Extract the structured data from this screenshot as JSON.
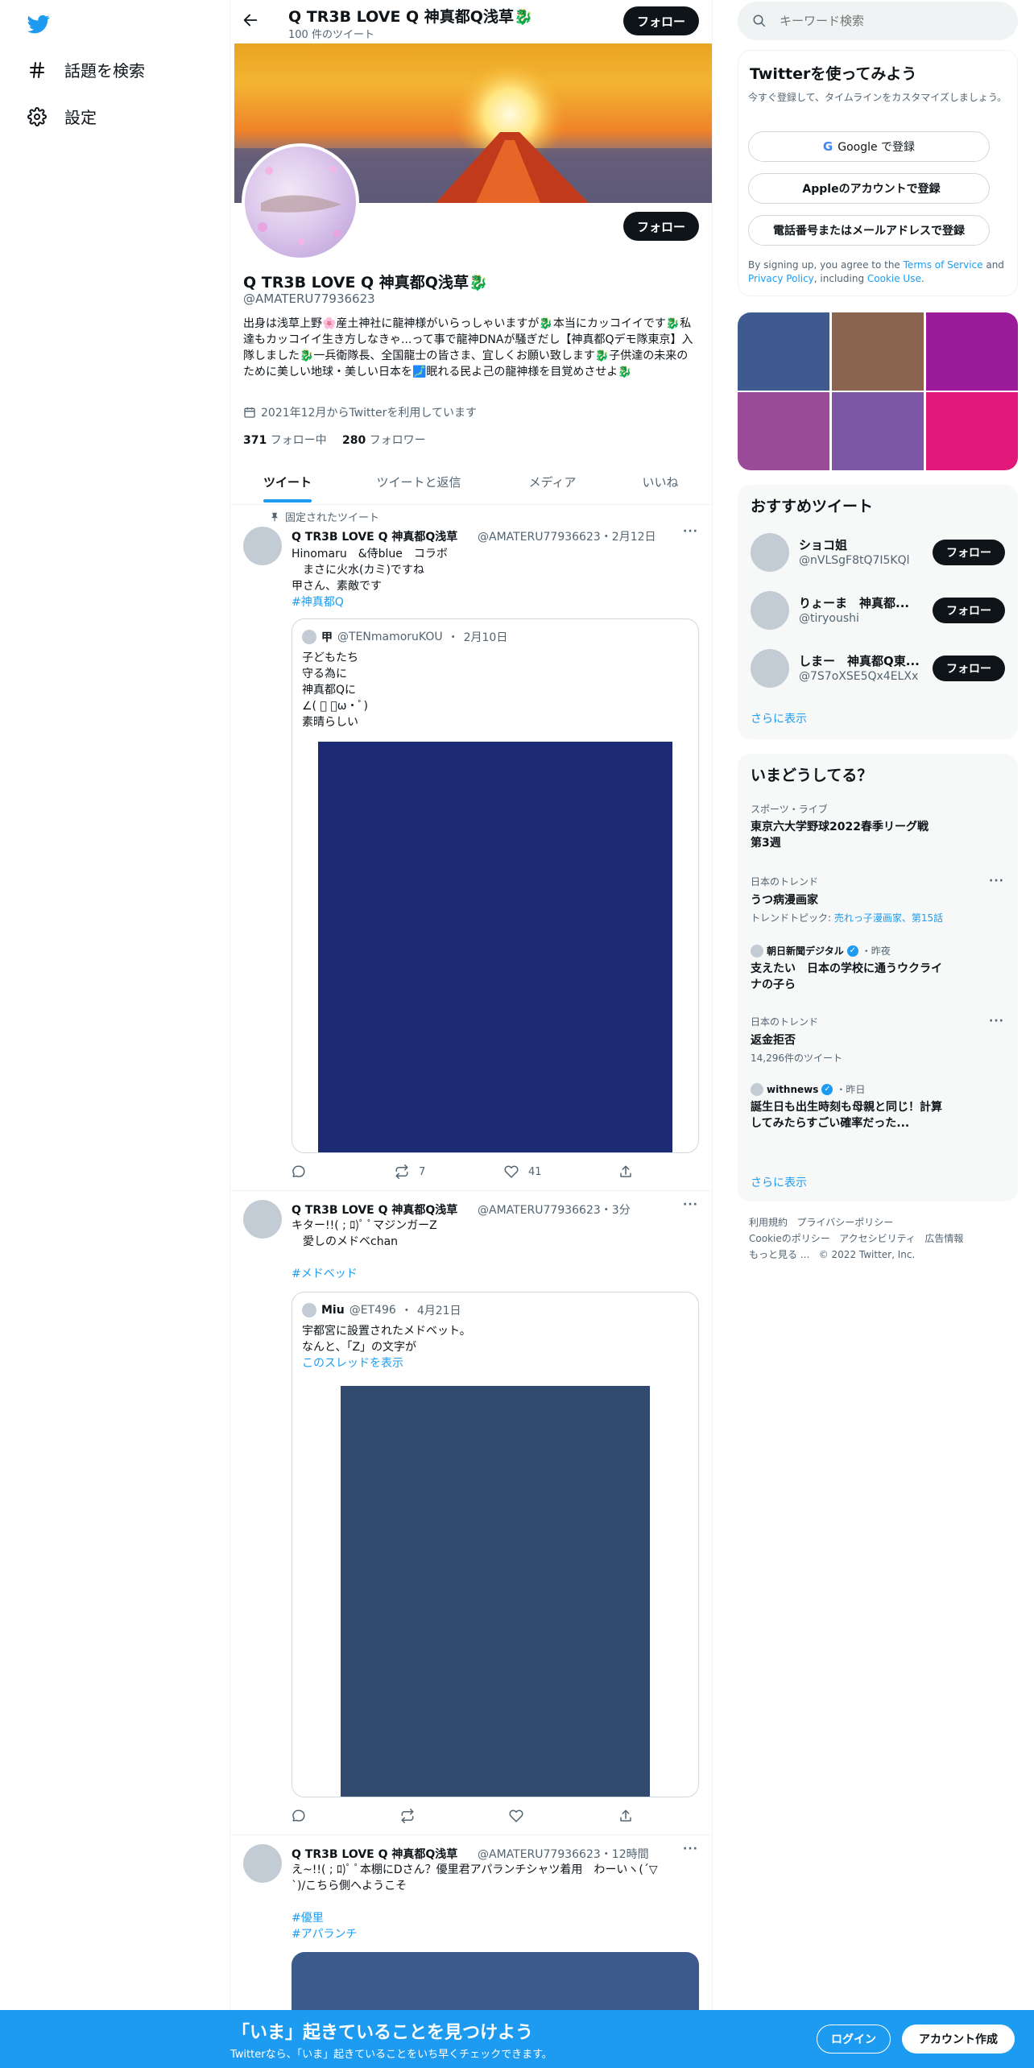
{
  "nav": {
    "explore_label": "話題を検索",
    "settings_label": "設定"
  },
  "profile_header": {
    "name": "Q TR3B LOVE Q 神真都Q浅草🐉",
    "tweet_count": "100 件のツイート",
    "follow_label": "フォロー"
  },
  "profile": {
    "name": "Q TR3B LOVE Q 神真都Q浅草🐉",
    "handle": "@AMATERU77936623",
    "bio": "出身は浅草上野🌸産土神社に龍神様がいらっしゃいますが🐉本当にカッコイイです🐉私達もカッコイイ生き方しなきゃ...って事で龍神DNAが騒ぎだし【神真都Qデモ隊東京】入隊しました🐉一兵衛隊長、全国龍士の皆さま、宜しくお願い致します🐉子供達の未来のために美しい地球・美しい日本を🗾眠れる民よ己の龍神様を目覚めさせよ🐉",
    "joined": "2021年12月からTwitterを利用しています",
    "following_count": "371",
    "following_label": "フォロー中",
    "followers_count": "280",
    "followers_label": "フォロワー",
    "follow_label": "フォロー"
  },
  "tabs": [
    "ツイート",
    "ツイートと返信",
    "メディア",
    "いいね"
  ],
  "tweets": [
    {
      "pinned_label": "固定されたツイート",
      "name": "Q TR3B LOVE Q 神真都Q浅草",
      "handle": "@AMATERU77936623",
      "time": "2月12日",
      "lines": [
        "Hinomaru　&侍blue　コラボ",
        "　まさに火水(カミ)ですね",
        "甲さん、素敵です"
      ],
      "hashtags": [
        "#神真都Q"
      ],
      "quote": {
        "name": "甲",
        "handle": "@TENmamoruKOU",
        "time": "2月10日",
        "lines": [
          "子どもたち",
          "守る為に",
          "神真都Qに",
          "∠( ﾟ ・ω・ﾟ)",
          "素晴らしい"
        ],
        "image_color": "#1b2a72"
      },
      "retweets": "7",
      "likes": "41"
    },
    {
      "name": "Q TR3B LOVE Q 神真都Q浅草",
      "handle": "@AMATERU77936623",
      "time": "3分",
      "lines": [
        "キター!!( ; ﾛ)ﾟ ﾟマジンガーZ",
        "　愛しのメドベchan"
      ],
      "hashtags": [
        "#メドベッド"
      ],
      "quote": {
        "name": "Miu",
        "handle": "@ET496",
        "time": "4月21日",
        "lines": [
          "宇都宮に設置されたメドベット。",
          "なんと、「Z」の文字が"
        ],
        "thread_link": "このスレッドを表示",
        "image_color": "#324a6d"
      },
      "retweets": "",
      "likes": ""
    },
    {
      "name": "Q TR3B LOVE Q 神真都Q浅草",
      "handle": "@AMATERU77936623",
      "time": "12時間",
      "lines": [
        "え~!!( ; ﾛ)ﾟ ﾟ本棚にDさん？優里君アパランチシャツ着用　わーいヽ(´▽",
        "`)/こちら側へようこそ"
      ],
      "hashtags": [
        "#優里",
        "#アパランチ"
      ],
      "image_color": "#3d5a8c"
    }
  ],
  "search": {
    "placeholder": "キーワード検索"
  },
  "signup": {
    "title": "Twitterを使ってみよう",
    "subtitle": "今すぐ登録して、タイムラインをカスタマイズしましょう。",
    "google_label": "Google で登録",
    "apple_label": "Appleのアカウントで登録",
    "phone_label": "電話番号またはメールアドレスで登録",
    "terms_prefix": "By signing up, you agree to the ",
    "terms_link": "Terms of Service",
    "terms_and": " and ",
    "privacy_link": "Privacy Policy",
    "terms_including": ", including ",
    "cookie_link": "Cookie Use",
    "terms_end": "."
  },
  "media_grid": {
    "colors": [
      "#3f5a8e",
      "#8b6450",
      "#9b1c9b",
      "#9b4a98",
      "#7e56a6",
      "#e0197a"
    ]
  },
  "recommended": {
    "title": "おすすめツイート",
    "users": [
      {
        "name": "ショコ姐",
        "handle": "@nVLSgF8tQ7I5KQl",
        "follow": "フォロー"
      },
      {
        "name": "りょーま　神真都...",
        "handle": "@tiryoushi",
        "follow": "フォロー"
      },
      {
        "name": "しまー　神真都Q東...",
        "handle": "@7S7oXSE5Qx4ELXx",
        "follow": "フォロー"
      }
    ],
    "more": "さらに表示"
  },
  "trends": {
    "title": "いまどうしてる？",
    "items": [
      {
        "context": "スポーツ・ライブ",
        "title": "東京六大学野球2022春季リーグ戦　第3週"
      },
      {
        "context": "日本のトレンド",
        "title": "うつ病漫画家",
        "sub_prefix": "トレンドトピック: ",
        "sub_link": "売れっ子漫画家、第15話"
      },
      {
        "source": "朝日新聞デジタル",
        "time": "・昨夜",
        "title": "支えたい　日本の学校に通うウクライナの子ら"
      },
      {
        "context": "日本のトレンド",
        "title": "返金拒否",
        "sub": "14,296件のツイート"
      },
      {
        "source": "withnews",
        "time": "・昨日",
        "title": "誕生日も出生時刻も母親と同じ！計算してみたらすごい確率だった..."
      }
    ],
    "more": "さらに表示"
  },
  "footer": {
    "links": [
      "利用規約",
      "プライバシーポリシー",
      "Cookieのポリシー",
      "アクセシビリティ",
      "広告情報",
      "もっと見る ..."
    ],
    "copyright": "© 2022 Twitter, Inc."
  },
  "banner": {
    "title": "「いま」起きていることを見つけよう",
    "subtitle": "Twitterなら、「いま」起きていることをいち早くチェックできます。",
    "login_label": "ログイン",
    "signup_label": "アカウント作成"
  },
  "colors": {
    "brand": "#1d9bf0",
    "banner_bg": "#1d9bf0"
  }
}
